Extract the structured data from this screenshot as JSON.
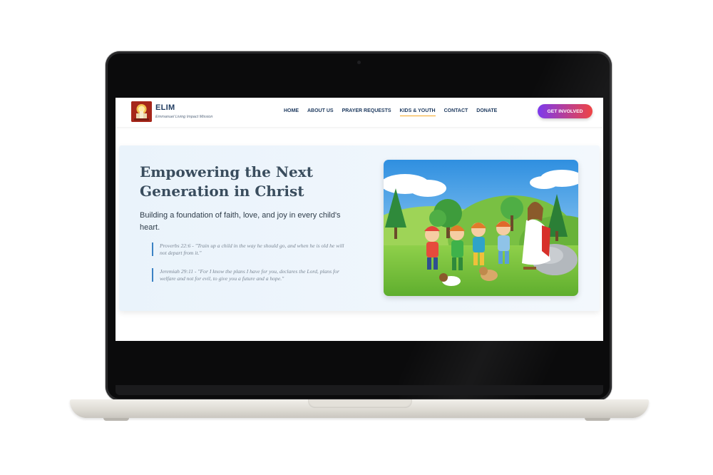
{
  "site": {
    "brand": "ELIM",
    "tagline": "Emmanuel Living Impact Mission"
  },
  "nav": {
    "items": [
      {
        "label": "HOME"
      },
      {
        "label": "ABOUT US"
      },
      {
        "label": "PRAYER REQUESTS"
      },
      {
        "label": "KIDS & YOUTH"
      },
      {
        "label": "CONTACT"
      },
      {
        "label": "DONATE"
      }
    ],
    "active": "KIDS & YOUTH",
    "cta_label": "GET INVOLVED"
  },
  "hero": {
    "title": "Empowering the Next Generation in Christ",
    "subtitle": "Building a foundation of faith, love, and joy in every child's heart.",
    "quotes": [
      {
        "text": "Proverbs 22:6 - \"Train up a child in the way he should go, and when he is old he will not depart from it.\""
      },
      {
        "text": "Jeremiah 29:11 - \"For I know the plans I have for you, declares the Lord, plans for welfare and not for evil, to give you a future and a hope.\""
      }
    ]
  },
  "colors": {
    "accent": "#1e3a5f",
    "active_underline": "#f5a623",
    "quote_bar": "#3b82c4",
    "cta_start": "#7c3aed",
    "cta_end": "#ef4444"
  }
}
